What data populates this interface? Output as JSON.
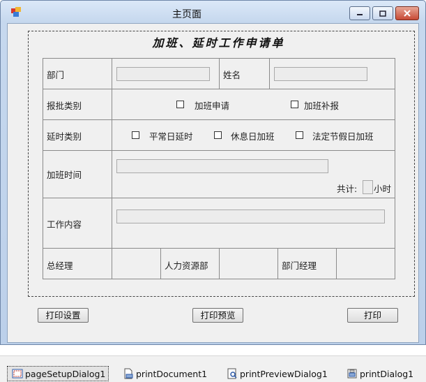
{
  "window": {
    "title": "主页面"
  },
  "form": {
    "title": "加班、延时工作申请单",
    "dept_label": "部门",
    "name_label": "姓名",
    "dept_value": "",
    "name_value": "",
    "approval_type_label": "报批类别",
    "approval_options": [
      "加班申请",
      "加班补报"
    ],
    "delay_type_label": "延时类别",
    "delay_options": [
      "平常日延时",
      "休息日加班",
      "法定节假日加班"
    ],
    "overtime_label": "加班时间",
    "overtime_value": "",
    "total_prefix": "共计:",
    "total_value": "",
    "total_unit": "小时",
    "work_content_label": "工作内容",
    "work_content_value": "",
    "gm_label": "总经理",
    "hr_label": "人力资源部",
    "dept_manager_label": "部门经理"
  },
  "buttons": {
    "print_setup": "打印设置",
    "print_preview": "打印预览",
    "print": "打印"
  },
  "component_tray": {
    "items": [
      {
        "label": "pageSetupDialog1",
        "icon": "page-setup-icon"
      },
      {
        "label": "printDocument1",
        "icon": "print-document-icon"
      },
      {
        "label": "printPreviewDialog1",
        "icon": "print-preview-icon"
      },
      {
        "label": "printDialog1",
        "icon": "print-dialog-icon"
      }
    ]
  },
  "colors": {
    "titlebar": "#c6d8ee",
    "close_button": "#c74a35",
    "client_bg": "#f0f0f0",
    "textbox_bg": "#ececec"
  }
}
